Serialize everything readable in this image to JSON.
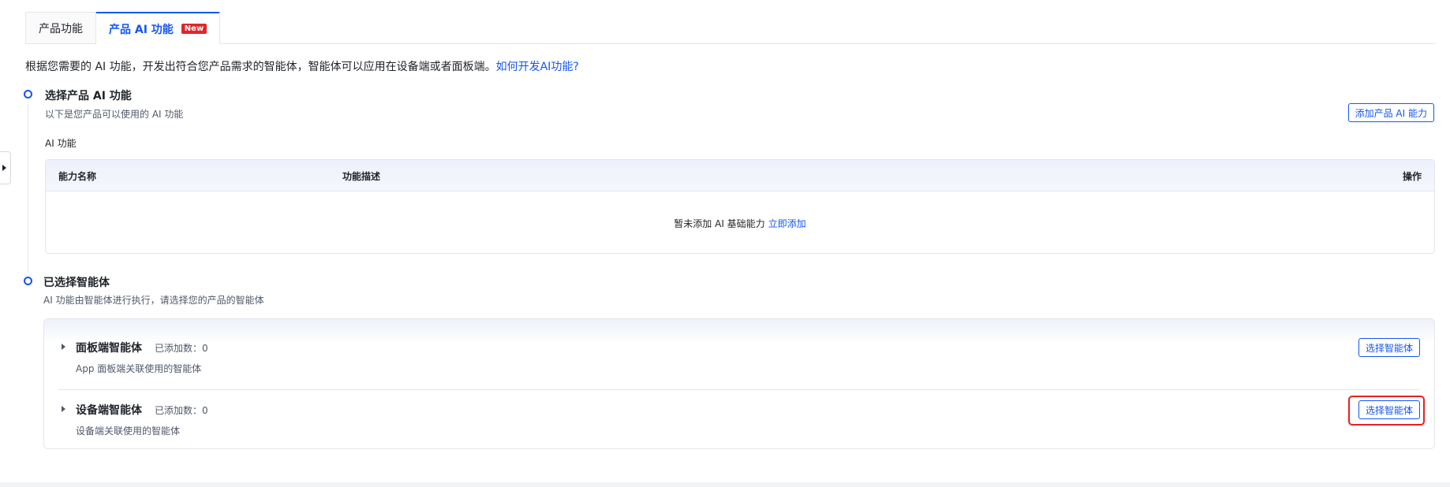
{
  "tabs": [
    {
      "label": "产品功能",
      "active": false
    },
    {
      "label": "产品 AI 功能",
      "active": true,
      "badge": "New"
    }
  ],
  "intro": {
    "text": "根据您需要的 AI 功能，开发出符合您产品需求的智能体，智能体可以应用在设备端或者面板端。",
    "link": "如何开发AI功能?"
  },
  "step1": {
    "title": "选择产品 AI 功能",
    "desc": "以下是您产品可以使用的 AI 功能",
    "add_button": "添加产品 AI 能力",
    "section_label": "AI 功能",
    "table": {
      "columns": [
        "能力名称",
        "功能描述",
        "操作"
      ],
      "empty_text": "暂未添加 AI 基础能力",
      "empty_link": "立即添加"
    }
  },
  "step2": {
    "title": "已选择智能体",
    "desc": "AI 功能由智能体进行执行，请选择您的产品的智能体",
    "agents": [
      {
        "name": "面板端智能体",
        "count_label": "已添加数：0",
        "desc": "App 面板端关联使用的智能体",
        "button": "选择智能体",
        "highlighted": false
      },
      {
        "name": "设备端智能体",
        "count_label": "已添加数：0",
        "desc": "设备端关联使用的智能体",
        "button": "选择智能体",
        "highlighted": true
      }
    ]
  },
  "colors": {
    "accent": "#1456f0",
    "badge": "#e0262a",
    "highlight": "#e4211f"
  }
}
